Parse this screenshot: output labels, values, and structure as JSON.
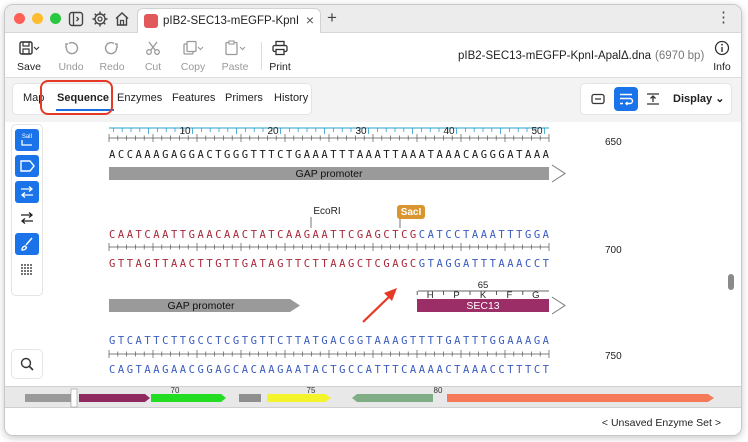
{
  "window": {
    "tab_title": "pIB2-SEC13-mEGFP-KpnI-Ap",
    "file_name": "pIB2-SEC13-mEGFP-KpnI-ApalΔ.dna",
    "bp_count": "(6970 bp)"
  },
  "toolbar": {
    "save": "Save",
    "undo": "Undo",
    "redo": "Redo",
    "cut": "Cut",
    "copy": "Copy",
    "paste": "Paste",
    "print": "Print",
    "info": "Info"
  },
  "tabs": {
    "map": "Map",
    "sequence": "Sequence",
    "enzymes": "Enzymes",
    "features": "Features",
    "primers": "Primers",
    "history": "History"
  },
  "display_button": "Display",
  "ruler": [
    "10",
    "20",
    "30",
    "40",
    "50"
  ],
  "rows": [
    {
      "position": "650",
      "top_strand": "ACCAAAGAGGACTGGGTTTCTGAAATTTAAATTAAATAAACAGGGATAAA",
      "feature": "GAP promoter"
    },
    {
      "position": "700",
      "enzymes": [
        {
          "name": "EcoRI"
        },
        {
          "name": "SacI"
        }
      ],
      "top_strand": "CAATCAATTGAACAACTATCAAGAATTCGAGCTCGCATCCTAAATTTGGA",
      "bottom_strand": "GTTAGTTAACTTGTTGATAGTTCTTAAGCTCGAGCGTAGGATTTAAACCT",
      "features": [
        "GAP promoter",
        "SEC13"
      ],
      "translation_number": "65",
      "amino_acids": [
        "H",
        "P",
        "K",
        "F",
        "G"
      ]
    },
    {
      "position": "750",
      "top_strand": "GTCATTCTTGCCTCGTGTTCTTATGACGGTAAAGTTTTGATTTGGAAAGA",
      "bottom_strand": "CAGTAAGAACGGAGCACAAGAATACTGCCATTTCAAAACTAAACCTTTCT"
    }
  ],
  "overview_numbers": [
    "70",
    "75",
    "80"
  ],
  "status": "< Unsaved Enzyme Set >",
  "colors": {
    "accent": "#1a73e8",
    "sequence_red": "#a8283a",
    "sequence_blue": "#3a5bbf",
    "gap_promoter": "#9a9a9a",
    "sec13": "#9b2e66",
    "saci_label": "#d9962e",
    "highlight": "#e63a28"
  }
}
